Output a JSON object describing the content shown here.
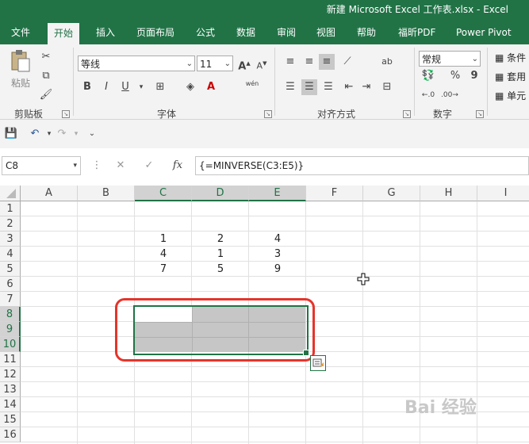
{
  "window": {
    "title": "新建 Microsoft Excel 工作表.xlsx  -  Excel"
  },
  "tabs": [
    {
      "label": "文件"
    },
    {
      "label": "开始"
    },
    {
      "label": "插入"
    },
    {
      "label": "页面布局"
    },
    {
      "label": "公式"
    },
    {
      "label": "数据"
    },
    {
      "label": "审阅"
    },
    {
      "label": "视图"
    },
    {
      "label": "帮助"
    },
    {
      "label": "福昕PDF"
    },
    {
      "label": "Power Pivot"
    }
  ],
  "ribbon": {
    "clipboard": {
      "group_label": "剪贴板",
      "paste_label": "粘贴"
    },
    "font": {
      "group_label": "字体",
      "font_name": "等线",
      "font_size": "11",
      "grow": "A",
      "shrink": "A",
      "bold": "B",
      "italic": "I",
      "underline": "U",
      "phonetic": "wén",
      "font_color_letter": "A"
    },
    "alignment": {
      "group_label": "对齐方式"
    },
    "number": {
      "group_label": "数字",
      "format": "常规",
      "percent": "%",
      "comma": "9"
    },
    "styles": {
      "conditional": "条件",
      "table": "套用",
      "cell": "单元"
    }
  },
  "formula_bar": {
    "name_box": "C8",
    "fx": "fx",
    "formula": "{=MINVERSE(C3:E5)}"
  },
  "sheet": {
    "columns": [
      "A",
      "B",
      "C",
      "D",
      "E",
      "F",
      "G",
      "H",
      "I"
    ],
    "rows": [
      "1",
      "2",
      "3",
      "4",
      "5",
      "6",
      "7",
      "8",
      "9",
      "10",
      "11",
      "12",
      "13",
      "14",
      "15",
      "16"
    ],
    "cells": {
      "C3": "1",
      "D3": "2",
      "E3": "4",
      "C4": "4",
      "D4": "1",
      "E4": "3",
      "C5": "7",
      "D5": "5",
      "E5": "9"
    }
  },
  "colors": {
    "accent": "#217346",
    "highlight": "#e5342b",
    "selection": "#c6c6c6"
  },
  "watermark": "Bai 经验"
}
